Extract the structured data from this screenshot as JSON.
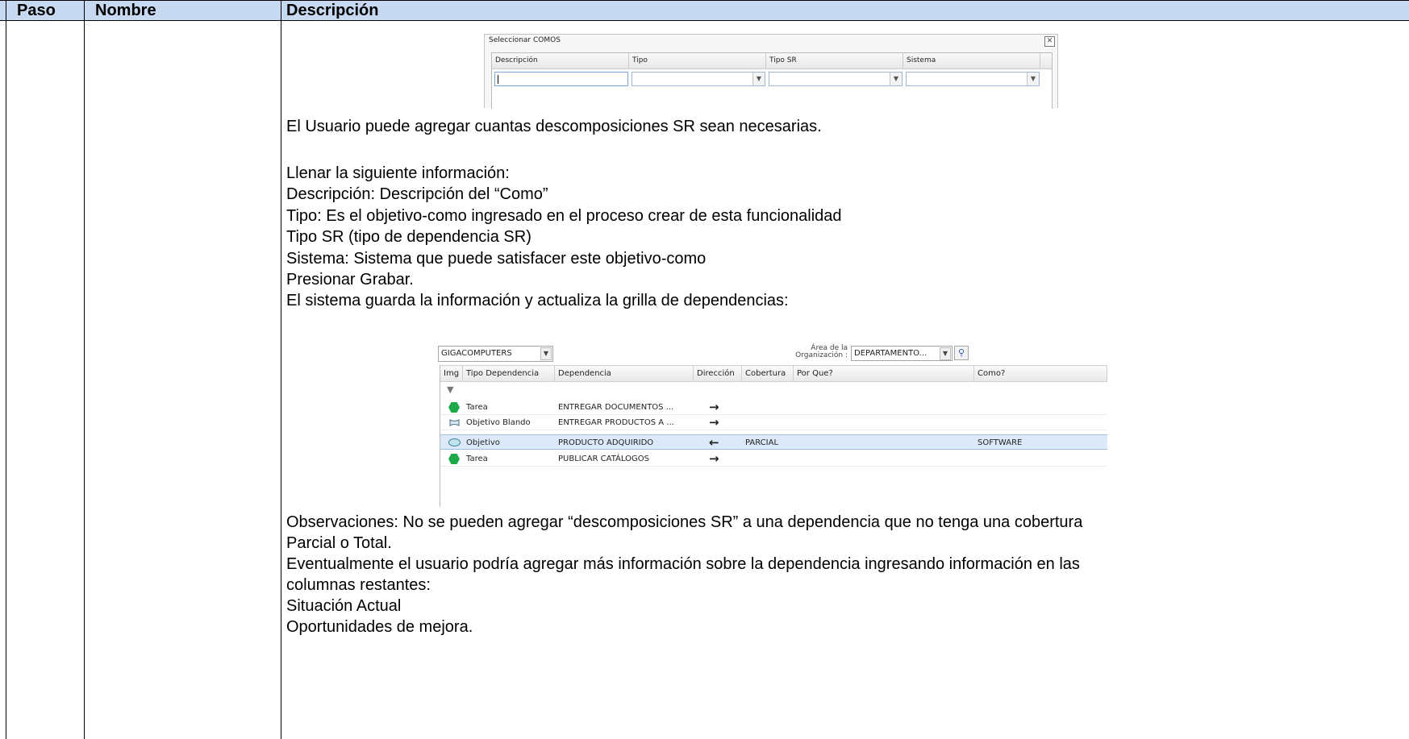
{
  "table": {
    "headers": {
      "paso": "Paso",
      "nombre": "Nombre",
      "descripcion": "Descripción"
    }
  },
  "comos_dialog": {
    "title": "Seleccionar COMOS",
    "close_glyph": "✕",
    "columns": [
      "Descripción",
      "Tipo",
      "Tipo SR",
      "Sistema"
    ],
    "descripcion_value": "",
    "tipo_value": "",
    "tipo_sr_value": "",
    "sistema_value": ""
  },
  "text": {
    "line1": "El Usuario puede agregar cuantas descomposiciones SR  sean necesarias.",
    "line2": "Llenar la siguiente información:",
    "line3": "Descripción: Descripción del “Como”",
    "line4": "Tipo: Es el objetivo-como ingresado en el proceso crear de esta funcionalidad",
    "line5": "Tipo SR (tipo de dependencia SR)",
    "line6": "Sistema: Sistema que puede satisfacer este objetivo-como",
    "line7": "Presionar Grabar.",
    "line8": "El sistema guarda la información y actualiza la grilla de dependencias:",
    "line9": "Observaciones: No se pueden agregar “descomposiciones SR” a una dependencia que no tenga una cobertura",
    "line10": "Parcial o Total.",
    "line11": "Eventualmente el usuario podría agregar más información sobre la dependencia ingresando información en las",
    "line12": "columnas restantes:",
    "line13": "Situación Actual",
    "line14": "Oportunidades de mejora."
  },
  "dependency_grid": {
    "organization": "GIGACOMPUTERS",
    "area_label_1": "Área de la",
    "area_label_2": "Organización :",
    "area_value": "DEPARTAMENTO...",
    "columns": {
      "img": "Img",
      "tipo": "Tipo Dependencia",
      "dependencia": "Dependencia",
      "direccion": "Dirección",
      "cobertura": "Cobertura",
      "por_que": "Por Que?",
      "como": "Como?"
    },
    "rows": [
      {
        "icon": "green-hexagon-icon",
        "tipo": "Tarea",
        "dependencia": "ENTREGAR DOCUMENTOS ...",
        "direccion": "→",
        "cobertura": "",
        "por_que": "",
        "como": ""
      },
      {
        "icon": "soft-goal-icon",
        "tipo": "Objetivo Blando",
        "dependencia": "ENTREGAR PRODUCTOS A ...",
        "direccion": "→",
        "cobertura": "",
        "por_que": "",
        "como": ""
      },
      {
        "icon": "oval-goal-icon",
        "tipo": "Objetivo",
        "dependencia": "PRODUCTO ADQUIRIDO",
        "direccion": "←",
        "cobertura": "PARCIAL",
        "por_que": "",
        "como": "SOFTWARE"
      },
      {
        "icon": "green-hexagon-icon",
        "tipo": "Tarea",
        "dependencia": "PUBLICAR CATÁLOGOS",
        "direccion": "→",
        "cobertura": "",
        "por_que": "",
        "como": ""
      }
    ],
    "selected_row": 2,
    "colors": {
      "task": "#1fa84a",
      "goal": "#bfe4ee",
      "selected": "#dce9f8"
    }
  }
}
